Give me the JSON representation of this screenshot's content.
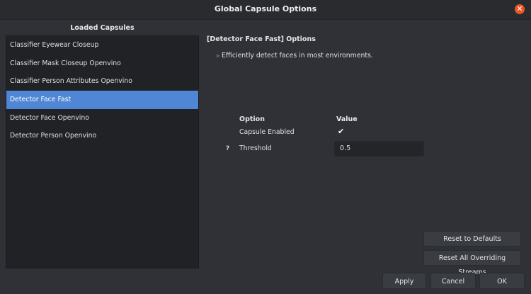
{
  "window": {
    "title": "Global Capsule Options",
    "close_icon": "close-icon",
    "accent_color": "#e95420"
  },
  "capsules": {
    "heading": "Loaded Capsules",
    "items": [
      "Classifier Eyewear Closeup",
      "Classifier Mask Closeup Openvino",
      "Classifier Person Attributes Openvino",
      "Detector Face Fast",
      "Detector Face Openvino",
      "Detector Person Openvino"
    ],
    "selected": "Detector Face Fast",
    "selection_color": "#4f86d5"
  },
  "options": {
    "header": "[Detector Face Fast] Options",
    "description": "Efficiently detect faces in most environments.",
    "columns": {
      "option": "Option",
      "value": "Value"
    },
    "rows": {
      "enabled_label": "Capsule Enabled",
      "enabled_value": true,
      "threshold_label": "Threshold",
      "threshold_value": "0.5",
      "threshold_help": "?"
    }
  },
  "buttons": {
    "reset_defaults": "Reset to Defaults",
    "reset_overriding": "Reset All Overriding Streams",
    "apply": "Apply",
    "cancel": "Cancel",
    "ok": "OK"
  }
}
